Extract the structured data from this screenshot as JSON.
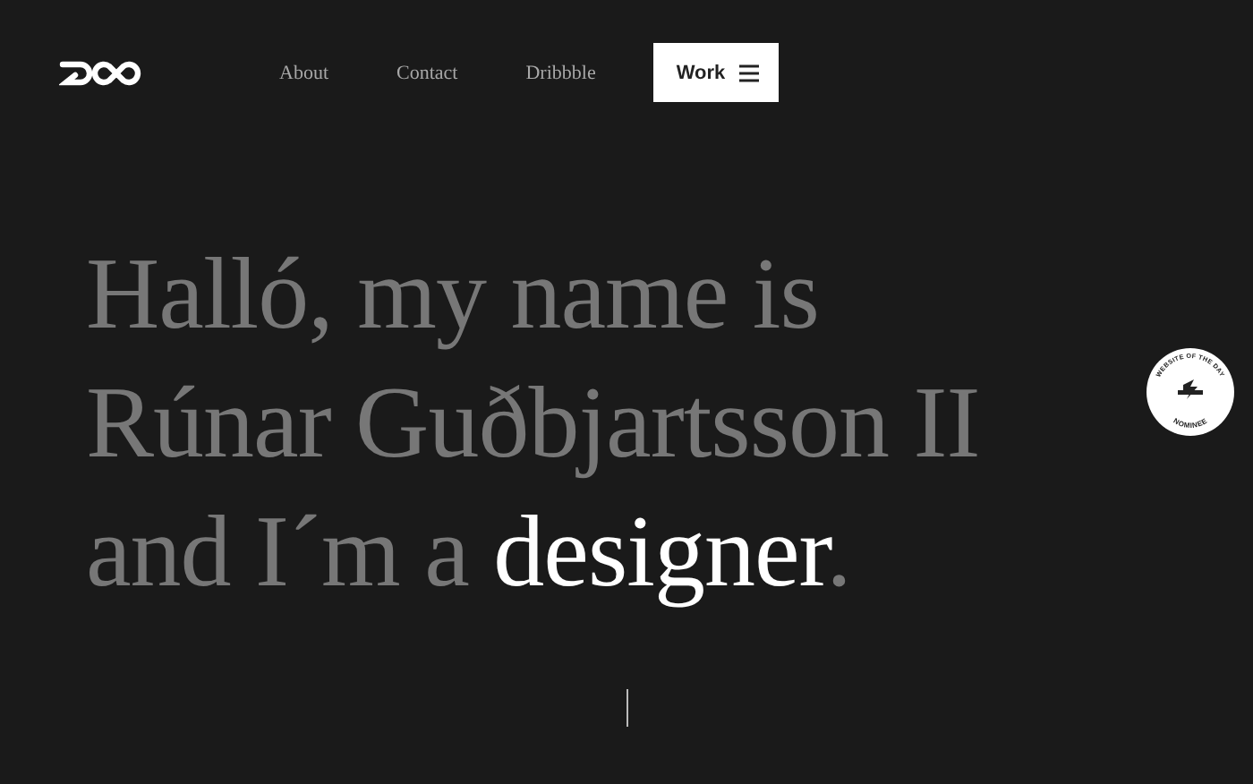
{
  "nav": {
    "links": [
      "About",
      "Contact",
      "Dribbble"
    ],
    "menu_button": "Work"
  },
  "hero": {
    "lines": [
      "Halló, my name is",
      "Rúnar Guðbjartsson II"
    ],
    "last_line": {
      "before": "and I´m a ",
      "highlight": "designer",
      "after": "."
    }
  },
  "badge": {
    "top": "WEBSITE OF THE DAY",
    "bottom": "NOMINEE"
  }
}
